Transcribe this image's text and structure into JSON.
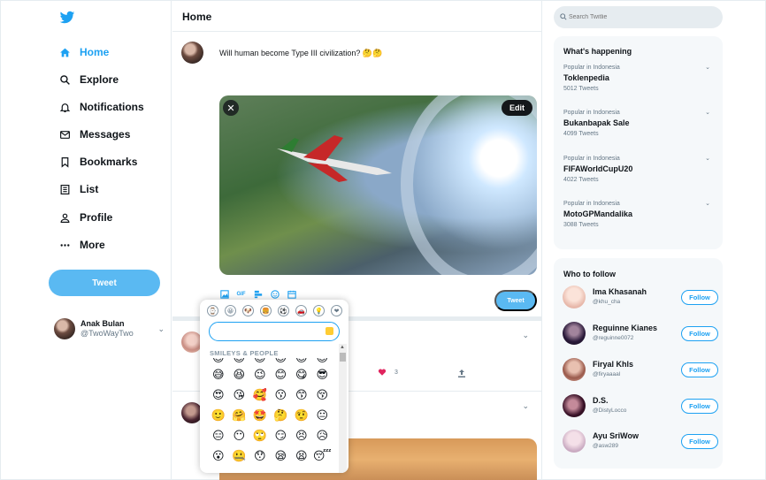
{
  "nav": {
    "items": [
      {
        "label": "Home",
        "icon": "home-icon"
      },
      {
        "label": "Explore",
        "icon": "search-icon"
      },
      {
        "label": "Notifications",
        "icon": "bell-icon"
      },
      {
        "label": "Messages",
        "icon": "mail-icon"
      },
      {
        "label": "Bookmarks",
        "icon": "bookmark-icon"
      },
      {
        "label": "List",
        "icon": "list-icon"
      },
      {
        "label": "Profile",
        "icon": "user-icon"
      },
      {
        "label": "More",
        "icon": "more-icon"
      }
    ],
    "tweet_button": "Tweet",
    "account": {
      "name": "Anak Bulan",
      "handle": "@TwoWayTwo"
    }
  },
  "main": {
    "title": "Home",
    "compose_text": "Will human become Type III civilization? 🤔🤔",
    "media_edit_label": "Edit",
    "post_button": "Tweet",
    "feed": [
      {
        "likes": "3"
      }
    ]
  },
  "emoji_picker": {
    "search_value": "",
    "category_label": "SMILEYS & PEOPLE",
    "categories": [
      "⌚",
      "😀",
      "🐶",
      "🍔",
      "⚽",
      "🚗",
      "💡",
      "❤",
      "🏳"
    ],
    "partial_row": [
      "😊",
      "😊",
      "😊",
      "😊",
      "😊",
      "😊"
    ],
    "emojis": [
      "😅",
      "😆",
      "😉",
      "😊",
      "😋",
      "😎",
      "😍",
      "😘",
      "🥰",
      "😗",
      "😙",
      "😚",
      "🙂",
      "🤗",
      "🤩",
      "🤔",
      "🤨",
      "😐",
      "😑",
      "😶",
      "🙄",
      "😏",
      "😣",
      "😥",
      "😮",
      "🤐",
      "😯",
      "😪",
      "😫",
      "😴"
    ]
  },
  "search": {
    "placeholder": "Search Twitlie"
  },
  "trends": {
    "title": "What's happening",
    "items": [
      {
        "context": "Popular in Indonesia",
        "name": "Toklenpedia",
        "count": "5012 Tweets"
      },
      {
        "context": "Popular in Indonesia",
        "name": "Bukanbapak Sale",
        "count": "4099 Tweets"
      },
      {
        "context": "Popular in Indonesia",
        "name": "FIFAWorldCupU20",
        "count": "4022 Tweets"
      },
      {
        "context": "Popular in Indonesia",
        "name": "MotoGPMandalika",
        "count": "3088 Tweets"
      }
    ]
  },
  "who_to_follow": {
    "title": "Who to follow",
    "follow_label": "Follow",
    "users": [
      {
        "name": "Ima Khasanah",
        "handle": "@khu_cha"
      },
      {
        "name": "Reguinne Kianes",
        "handle": "@reguinne0072"
      },
      {
        "name": "Firyal Khls",
        "handle": "@firyaaaal"
      },
      {
        "name": "D.S.",
        "handle": "@DistyLocco"
      },
      {
        "name": "Ayu SriWow",
        "handle": "@asw289"
      }
    ]
  },
  "colors": {
    "accent": "#1da1f2",
    "button": "#5ab9f2",
    "panel": "#f5f8fa",
    "border": "#e6ecf0"
  }
}
